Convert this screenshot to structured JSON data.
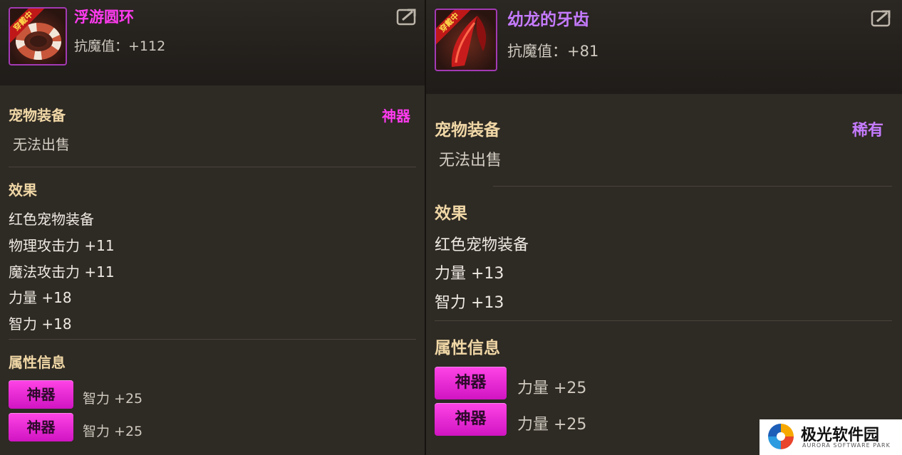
{
  "left": {
    "item_name": "浮游圆环",
    "worn_badge": "穿戴中",
    "stat": "抗魔值：+112",
    "category": "宠物装备",
    "quality": "神器",
    "sell_status": "无法出售",
    "effects_title": "效果",
    "effects": [
      "红色宠物装备",
      "物理攻击力 +11",
      "魔法攻击力 +11",
      "力量 +18",
      "智力 +18"
    ],
    "attr_title": "属性信息",
    "attributes": [
      {
        "badge": "神器",
        "value": "智力 +25"
      },
      {
        "badge": "神器",
        "value": "智力 +25"
      }
    ]
  },
  "right": {
    "item_name": "幼龙的牙齿",
    "worn_badge": "穿戴中",
    "stat": "抗魔值：+81",
    "category": "宠物装备",
    "quality": "稀有",
    "sell_status": "无法出售",
    "effects_title": "效果",
    "effects": [
      "红色宠物装备",
      "力量 +13",
      "智力 +13"
    ],
    "attr_title": "属性信息",
    "attributes": [
      {
        "badge": "神器",
        "value": "力量 +25"
      },
      {
        "badge": "神器",
        "value": "力量 +25"
      }
    ]
  },
  "watermark": {
    "name": "极光软件园",
    "sub": "AURORA SOFTWARE PARK"
  },
  "colors": {
    "artifact": "#ff3bf0",
    "rare": "#c57bff",
    "section_title": "#f0d7a6",
    "panel_bg": "#2e2a24"
  },
  "icons": [
    "share-icon",
    "ring-item-icon",
    "fang-item-icon",
    "aurora-logo-icon"
  ]
}
